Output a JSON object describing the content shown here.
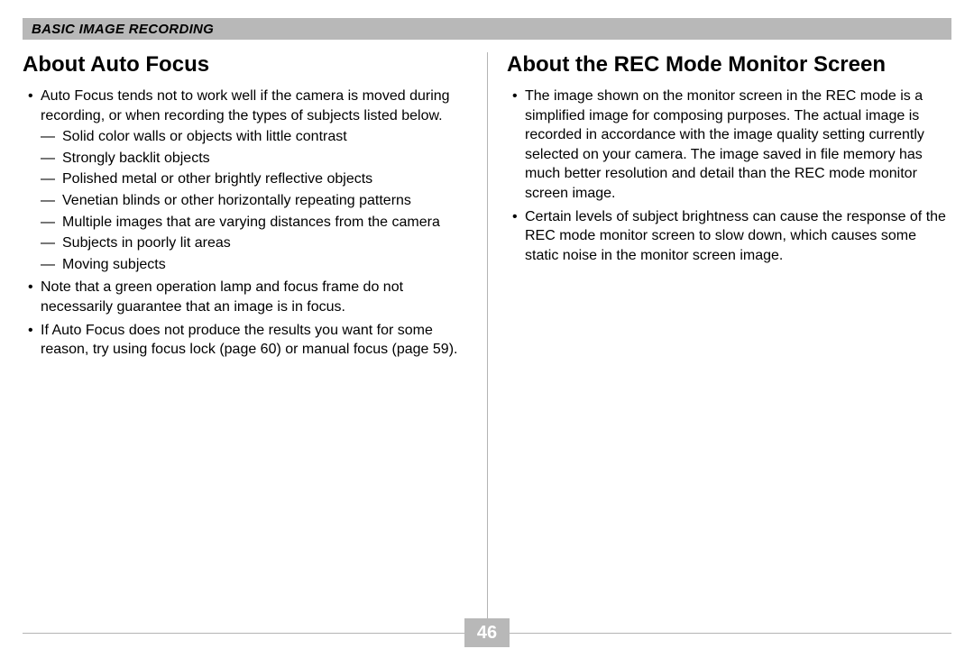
{
  "header": {
    "section_title": "BASIC IMAGE RECORDING"
  },
  "left_column": {
    "heading": "About Auto Focus",
    "bullets": [
      {
        "text": "Auto Focus tends not to work well if the camera is moved during recording, or when recording the types of subjects listed below.",
        "sub": [
          "Solid color walls or objects with little contrast",
          "Strongly backlit objects",
          "Polished metal or other brightly reflective objects",
          "Venetian blinds or other horizontally repeating patterns",
          "Multiple images that are varying distances from the camera",
          "Subjects in poorly lit areas",
          "Moving subjects"
        ]
      },
      {
        "text": "Note that a green operation lamp and focus frame do not necessarily guarantee that an image is in focus."
      },
      {
        "text": "If Auto Focus does not produce the results you want for some reason, try using focus lock (page 60) or manual focus (page 59)."
      }
    ]
  },
  "right_column": {
    "heading": "About the REC Mode Monitor Screen",
    "bullets": [
      {
        "text": "The image shown on the monitor screen in the REC mode is a simplified image for composing purposes. The actual image is recorded in accordance with the image quality setting currently selected on your camera. The image saved in file memory has much better resolution and detail than the REC mode monitor screen image."
      },
      {
        "text": "Certain levels of subject brightness can cause the response of the REC mode monitor screen to slow down, which causes some static noise in the monitor screen image."
      }
    ]
  },
  "page_number": "46"
}
